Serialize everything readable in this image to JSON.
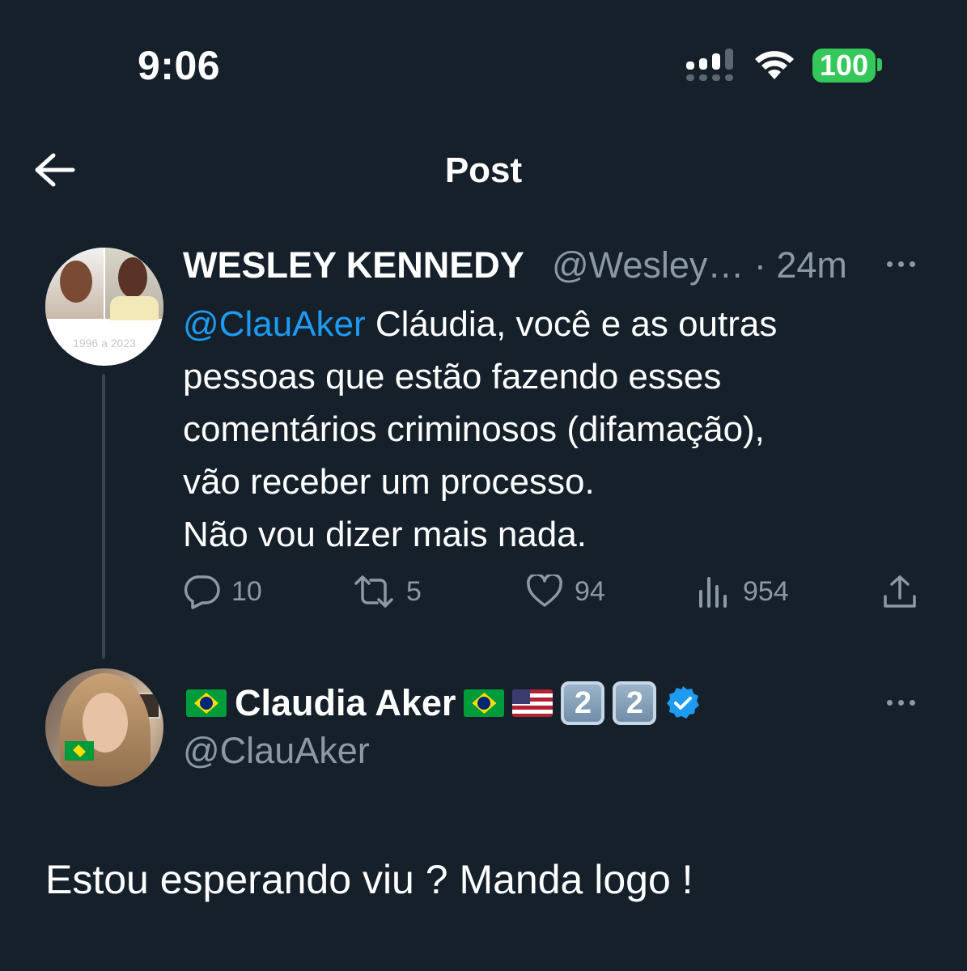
{
  "status_bar": {
    "time": "9:06",
    "battery": "100",
    "icons": [
      "signal-icon",
      "wifi-icon",
      "battery-icon"
    ]
  },
  "nav": {
    "title": "Post",
    "back_icon": "arrow-left-icon"
  },
  "parent_post": {
    "display_name": "WESLEY KENNEDY",
    "handle_time": "@Wesley… · 24m",
    "avatar_caption": "1996 a 2023",
    "mention": "@ClauAker",
    "text_lines": [
      "Cláudia, você e as outras",
      "pessoas que estão fazendo esses",
      "comentários criminosos (difamação),",
      "vão receber um processo.",
      "Não vou dizer mais nada."
    ],
    "actions": {
      "replies": "10",
      "reposts": "5",
      "likes": "94",
      "views": "954"
    }
  },
  "reply_post": {
    "display_name": "Claudia Aker",
    "name_emojis": [
      "flag-brazil",
      "flag-brazil",
      "flag-usa",
      "keycap-2",
      "keycap-2",
      "verified-badge"
    ],
    "keycap_label": "2",
    "handle": "@ClauAker",
    "text": "Estou esperando viu ? Manda logo !"
  },
  "colors": {
    "background": "#15202b",
    "text": "#ffffff",
    "secondary": "#8b98a5",
    "accent": "#1d9bf0",
    "battery": "#34c759"
  }
}
